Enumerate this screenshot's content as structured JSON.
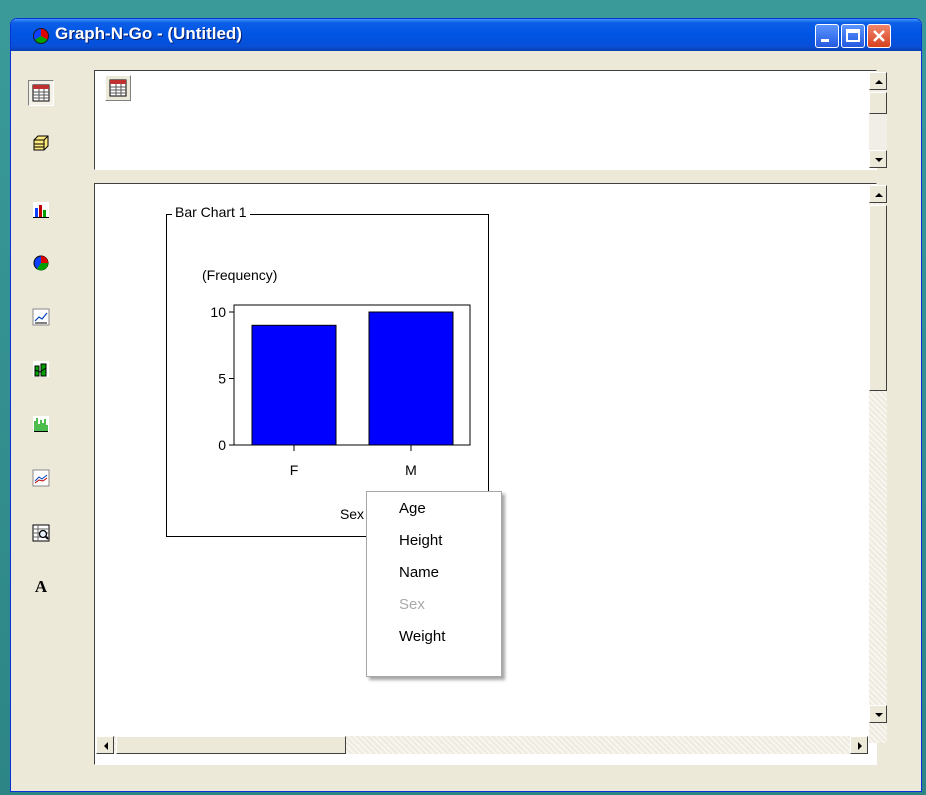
{
  "window": {
    "title": "Graph-N-Go - (Untitled)"
  },
  "toolbar": {
    "tools": [
      {
        "icon": "table-icon",
        "pressed": true
      },
      {
        "icon": "cube-icon",
        "pressed": false
      },
      {
        "icon": "bar-chart-icon",
        "pressed": false
      },
      {
        "icon": "pie-chart-icon",
        "pressed": false
      },
      {
        "icon": "line-chart-icon",
        "pressed": false
      },
      {
        "icon": "area-bar-chart-icon",
        "pressed": false
      },
      {
        "icon": "histogram-icon",
        "pressed": false
      },
      {
        "icon": "plot-icon",
        "pressed": false
      },
      {
        "icon": "table-zoom-icon",
        "pressed": false
      },
      {
        "icon": "text-icon",
        "label": "A",
        "pressed": false
      }
    ]
  },
  "chart_frame": {
    "label": "Bar Chart 1"
  },
  "chart_data": {
    "type": "bar",
    "categories": [
      "F",
      "M"
    ],
    "values": [
      9,
      10
    ],
    "title": "",
    "ylabel": "(Frequency)",
    "xlabel": "Sex",
    "ylim": [
      0,
      10
    ],
    "yticks": [
      "0",
      "5",
      "10"
    ],
    "bar_color": "#0000ff"
  },
  "context_menu": {
    "items": [
      {
        "label": "Age",
        "disabled": false
      },
      {
        "label": "Height",
        "disabled": false
      },
      {
        "label": "Name",
        "disabled": false
      },
      {
        "label": "Sex",
        "disabled": true
      },
      {
        "label": "Weight",
        "disabled": false
      }
    ]
  }
}
